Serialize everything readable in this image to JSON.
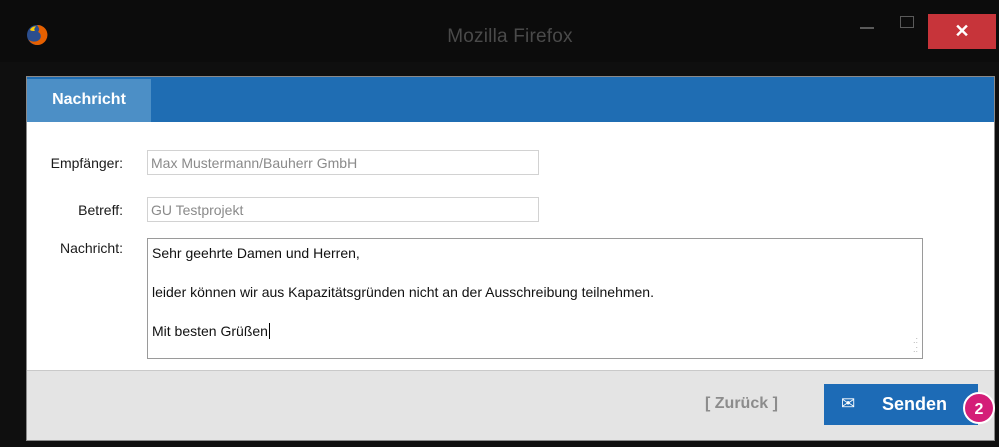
{
  "window": {
    "title": "Mozilla Firefox",
    "close_symbol": "✕",
    "icons": [
      "firefox-icon",
      "minimize-icon",
      "maximize-icon",
      "close-icon"
    ]
  },
  "dialog": {
    "tab_label": "Nachricht",
    "fields": {
      "recipient_label": "Empfänger:",
      "recipient_value": "Max Mustermann/Bauherr GmbH",
      "subject_label": "Betreff:",
      "subject_value": "GU Testprojekt",
      "message_label": "Nachricht:",
      "message_lines": [
        "Sehr geehrte Damen und Herren,",
        "leider können wir aus Kapazitätsgründen nicht an der Ausschreibung teilnehmen.",
        "Mit besten Grüßen"
      ]
    },
    "footer": {
      "back_label": "[ Zurück ]",
      "send_label": "Senden",
      "send_icon": "envelope-icon",
      "send_icon_symbol": "✉"
    }
  },
  "annotation": {
    "badge_number": "2"
  },
  "colors": {
    "tab_bar": "#1f6db3",
    "tab_active": "#4c8fc6",
    "send_button": "#1d6bb6",
    "close_button": "#c7343a",
    "badge": "#d41e78"
  }
}
